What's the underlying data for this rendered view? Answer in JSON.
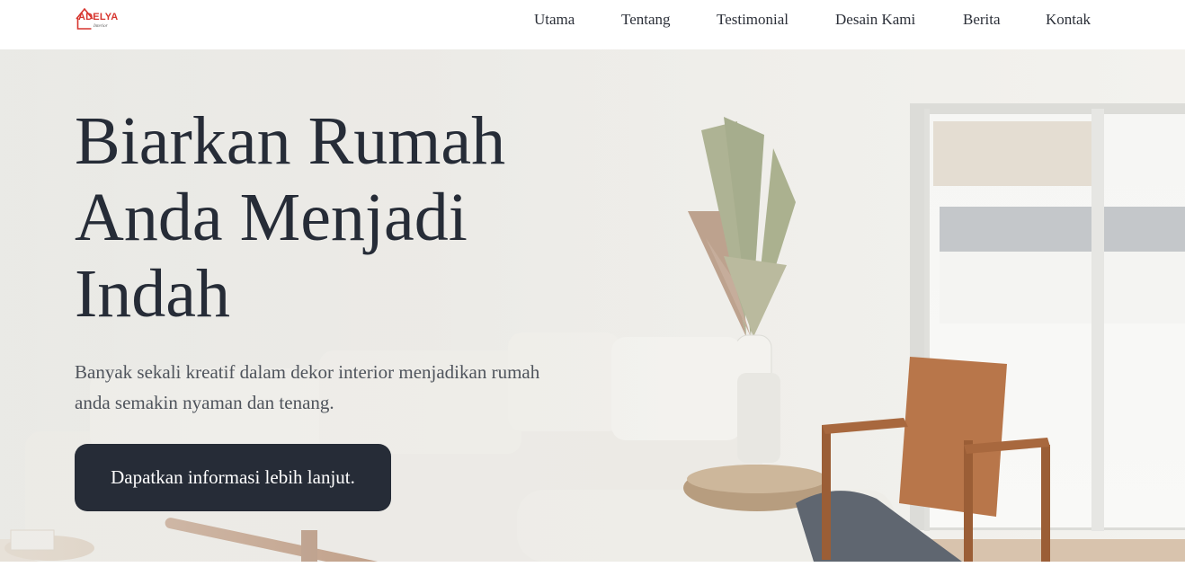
{
  "brand": {
    "name": "ADELYA",
    "tagline": "Interior",
    "accent_color": "#d7352e",
    "icon": "house-outline-icon"
  },
  "nav": {
    "items": [
      {
        "label": "Utama"
      },
      {
        "label": "Tentang"
      },
      {
        "label": "Testimonial"
      },
      {
        "label": "Desain Kami"
      },
      {
        "label": "Berita"
      },
      {
        "label": "Kontak"
      }
    ]
  },
  "hero": {
    "title": "Biarkan Rumah Anda Menjadi Indah",
    "subtitle": "Banyak sekali kreatif dalam dekor interior menjadikan rumah anda semakin nyaman dan tenang.",
    "cta_label": "Dapatkan informasi lebih lanjut.",
    "text_color": "#262c37",
    "button_color": "#262c37"
  }
}
